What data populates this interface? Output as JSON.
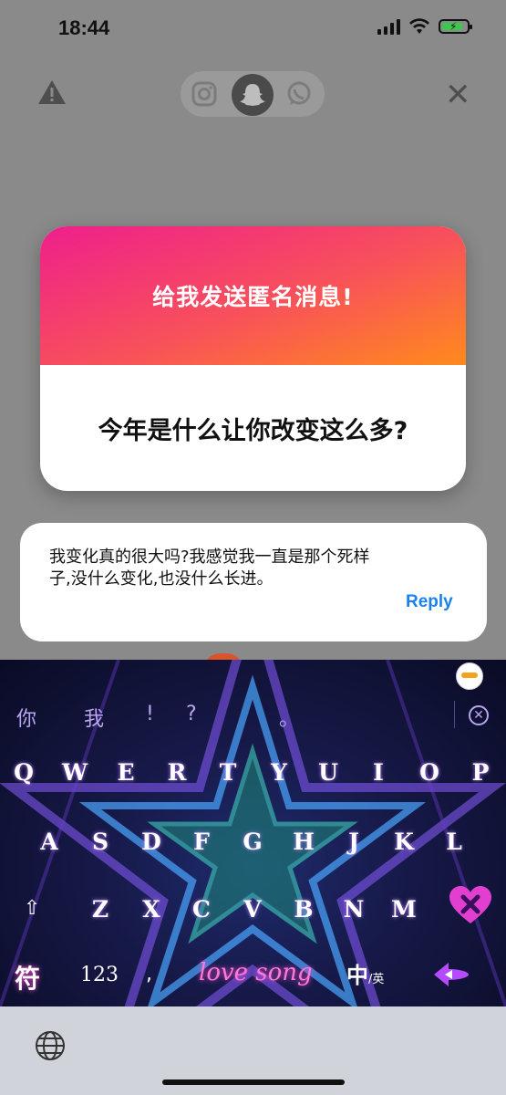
{
  "status_bar": {
    "time": "18:44",
    "battery_percent": 75
  },
  "toolbar": {
    "platforms": [
      "instagram-icon",
      "snapchat-icon",
      "whatsapp-icon"
    ],
    "selected_platform": "snapchat-icon"
  },
  "question_card": {
    "header": "给我发送匿名消息!",
    "question": "今年是什么让你改变这么多?",
    "gradient": [
      "#ef1f8c",
      "#ff8a1c"
    ]
  },
  "reply_card": {
    "text": "我变化真的很大吗?我感觉我一直是那个死样子,没什么变化,也没什么长进。",
    "reply_label": "Reply",
    "reply_color": "#1a82ef"
  },
  "keyboard": {
    "candidates": [
      "你",
      "我",
      "!",
      "?",
      "。"
    ],
    "row1": [
      "Q",
      "W",
      "E",
      "R",
      "T",
      "Y",
      "U",
      "I",
      "O",
      "P"
    ],
    "row2": [
      "A",
      "S",
      "D",
      "F",
      "G",
      "H",
      "J",
      "K",
      "L"
    ],
    "row3": [
      "Z",
      "X",
      "C",
      "V",
      "B",
      "N",
      "M"
    ],
    "symbols_key": "符",
    "numbers_key": "123",
    "comma_key": ",",
    "space_label": "love song",
    "lang_key": "中",
    "lang_alt": "/英"
  }
}
